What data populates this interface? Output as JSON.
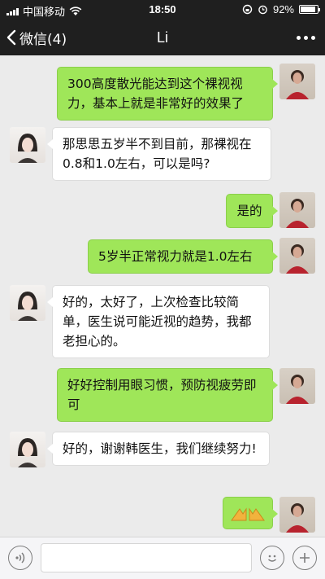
{
  "status_bar": {
    "carrier": "中国移动",
    "time": "18:50",
    "battery": "92%",
    "battery_level": 0.92
  },
  "nav": {
    "back_label": "微信(4)",
    "title": "Li"
  },
  "messages": [
    {
      "side": "out",
      "text": "300高度散光能达到这个裸视视力，基本上就是非常好的效果了"
    },
    {
      "side": "in",
      "text": "那思思五岁半不到目前，那裸视在0.8和1.0左右，可以是吗?"
    },
    {
      "side": "out",
      "text": "是的"
    },
    {
      "side": "out",
      "text": "5岁半正常视力就是1.0左右"
    },
    {
      "side": "in",
      "text": "好的，太好了，上次检查比较简单，医生说可能近视的趋势，我都老担心的。"
    },
    {
      "side": "out",
      "text": "好好控制用眼习惯，预防视疲劳即可"
    },
    {
      "side": "in",
      "text": "好的，谢谢韩医生，我们继续努力!"
    },
    {
      "side": "out",
      "emoji": "👐"
    }
  ],
  "input": {
    "placeholder": ""
  }
}
